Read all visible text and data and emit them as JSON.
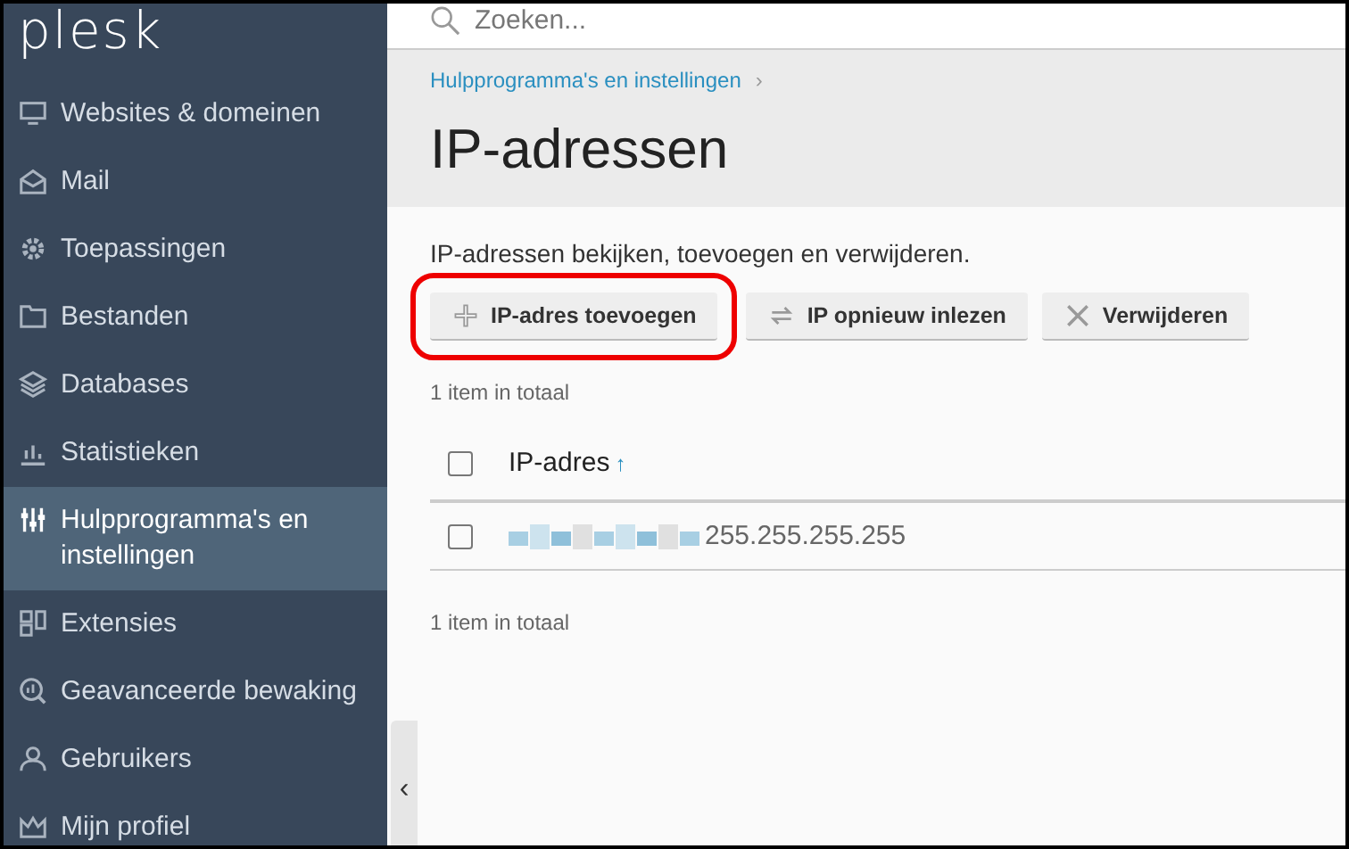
{
  "sidebar": {
    "logo": "plesk",
    "items": [
      {
        "label": "Websites & domeinen",
        "selected": false
      },
      {
        "label": "Mail",
        "selected": false
      },
      {
        "label": "Toepassingen",
        "selected": false
      },
      {
        "label": "Bestanden",
        "selected": false
      },
      {
        "label": "Databases",
        "selected": false
      },
      {
        "label": "Statistieken",
        "selected": false
      },
      {
        "label": "Hulpprogramma's en instellingen",
        "selected": true
      },
      {
        "label": "Extensies",
        "selected": false
      },
      {
        "label": "Geavanceerde bewaking",
        "selected": false
      },
      {
        "label": "Gebruikers",
        "selected": false
      },
      {
        "label": "Mijn profiel",
        "selected": false
      }
    ],
    "collapse": "‹"
  },
  "search": {
    "placeholder": "Zoeken..."
  },
  "breadcrumb": [
    {
      "label": "Hulpprogramma's en instellingen",
      "separator": "›"
    }
  ],
  "title": "IP-adressen",
  "description": "IP-adressen bekijken, toevoegen en verwijderen.",
  "toolbar": [
    {
      "label": "IP-adres toevoegen",
      "kind": "add",
      "highlighted": true
    },
    {
      "label": "IP opnieuw inlezen",
      "kind": "reload",
      "highlighted": false
    },
    {
      "label": "Verwijderen",
      "kind": "remove",
      "highlighted": false
    }
  ],
  "count_top": "1 item in totaal",
  "table": {
    "select_all": {
      "checked": false
    },
    "columns": [
      {
        "label": "IP-adres",
        "sort": "↑"
      }
    ],
    "rows": [
      {
        "checked": false,
        "ip": "255.255.255.255"
      }
    ]
  },
  "count_bottom": "1 item in totaal"
}
